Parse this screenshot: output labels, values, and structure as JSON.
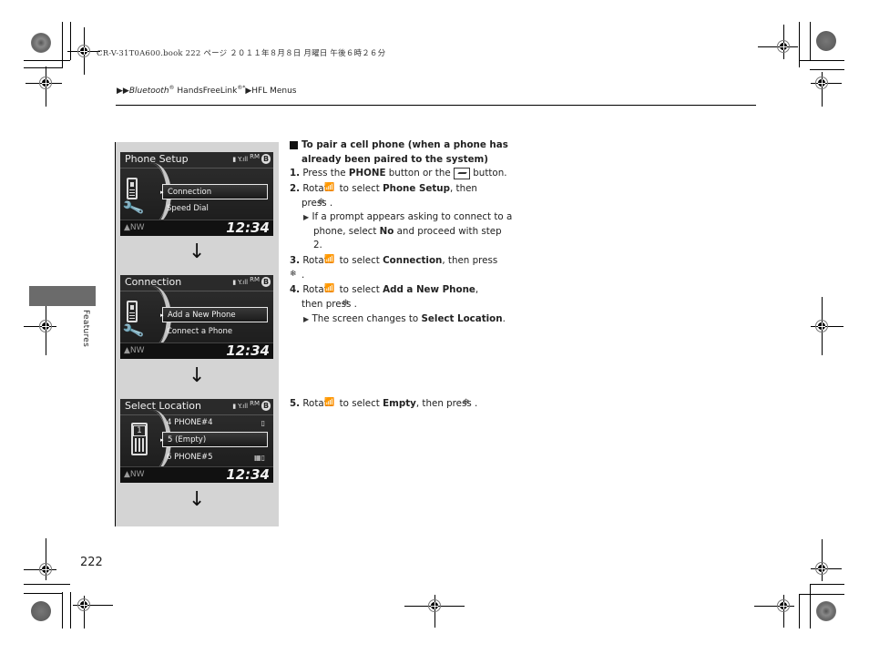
{
  "header": {
    "print_info": "CR-V-31T0A600.book  222 ページ  ２０１１年８月８日  月曜日  午後６時２６分",
    "breadcrumb": {
      "prefix": "▶▶",
      "part1_italic": "Bluetooth",
      "part1_sup": "®",
      "part2": " HandsFreeLink",
      "part2_sup": "®*",
      "sep": "▶",
      "part3": "HFL Menus"
    }
  },
  "side_tab": {
    "label": "Features"
  },
  "page_number": "222",
  "screens": [
    {
      "title": "Phone Setup",
      "status": {
        "battery": "▮",
        "signal": "Y.ıll",
        "roam": "RM",
        "bluetooth": "B"
      },
      "items": [
        {
          "label": "Connection",
          "selected": true,
          "right_icon": ""
        },
        {
          "label": "Speed Dial",
          "selected": false,
          "right_icon": ""
        }
      ],
      "footer": {
        "heading": "▲NW",
        "clock": "12:34"
      }
    },
    {
      "title": "Connection",
      "status": {
        "battery": "▮",
        "signal": "Y.ıll",
        "roam": "RM",
        "bluetooth": "B"
      },
      "items": [
        {
          "label": "Add a New Phone",
          "selected": true,
          "right_icon": ""
        },
        {
          "label": "Connect a Phone",
          "selected": false,
          "right_icon": ""
        }
      ],
      "footer": {
        "heading": "▲NW",
        "clock": "12:34"
      }
    },
    {
      "title": "Select Location",
      "status": {
        "battery": "▮",
        "signal": "Y.ıll",
        "roam": "RM",
        "bluetooth": "B"
      },
      "slot_number": "1",
      "items": [
        {
          "label": "4 PHONE#4",
          "selected": false,
          "right_icon": "▯"
        },
        {
          "label": "5 (Empty)",
          "selected": true,
          "right_icon": ""
        },
        {
          "label": "6 PHONE#5",
          "selected": false,
          "right_icon": "▦▯"
        }
      ],
      "footer": {
        "heading": "▲NW",
        "clock": "12:34"
      }
    }
  ],
  "flow_arrow": "↓",
  "instructions": {
    "heading": "To pair a cell phone (when a phone has already been paired to the system)",
    "steps": [
      {
        "num": "1.",
        "parts": [
          "Press the ",
          "PHONE",
          " button or the ",
          "[phone-button]",
          " button."
        ]
      },
      {
        "num": "2.",
        "parts": [
          "Rotate ",
          "[knob]",
          " to select ",
          "Phone Setup",
          ", then press ",
          "[press]",
          "."
        ],
        "note": "If a prompt appears asking to connect to a phone, select No and proceed with step 2."
      },
      {
        "num": "3.",
        "parts": [
          "Rotate ",
          "[knob]",
          " to select ",
          "Connection",
          ", then press ",
          "[press]",
          "."
        ]
      },
      {
        "num": "4.",
        "parts": [
          "Rotate ",
          "[knob]",
          " to select ",
          "Add a New Phone",
          ", then press ",
          "[press]",
          "."
        ],
        "note": "The screen changes to Select Location."
      },
      {
        "num": "5.",
        "parts": [
          "Rotate ",
          "[knob]",
          " to select ",
          "Empty",
          ", then press ",
          "[press]",
          "."
        ]
      }
    ],
    "text": {
      "s1a": "Press the ",
      "s1b": "PHONE",
      "s1c": " button or the ",
      "s1d": " button.",
      "rotate": "Rotate ",
      "to_select": " to select ",
      "then_press": ", then press ",
      "then_press2": ", then",
      "press": "press ",
      "period": ".",
      "s2b": "Phone Setup",
      "n2a": "If a prompt appears asking to connect to a phone, select ",
      "n2b": "No",
      "n2c": " and proceed with step 2.",
      "s3b": "Connection",
      "s4b": "Add a New Phone",
      "n4a": "The screen changes to ",
      "n4b": "Select Location",
      "n4c": ".",
      "s5b": "Empty"
    },
    "icons": {
      "knob": "knob-icon",
      "press": "press-icon",
      "phone": "phone-button-icon"
    }
  }
}
